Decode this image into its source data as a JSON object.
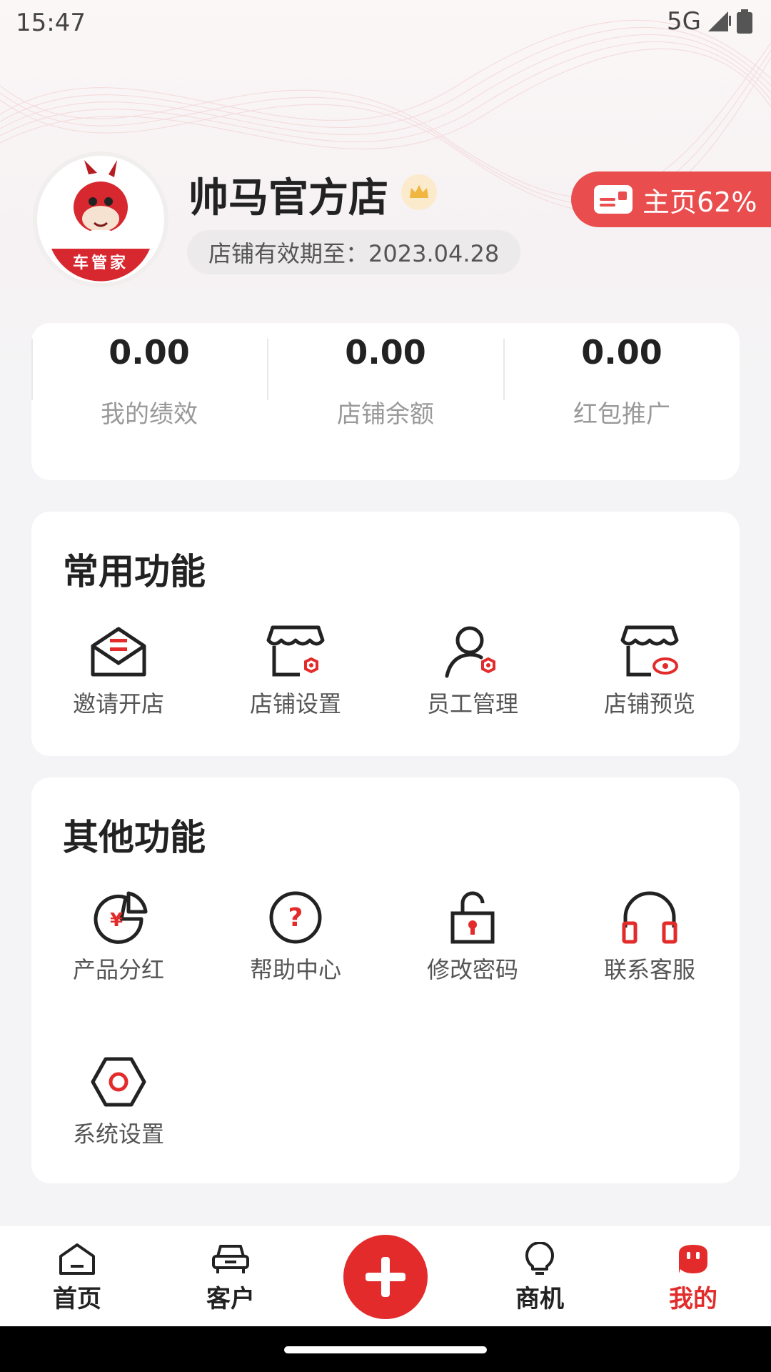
{
  "status_bar": {
    "time": "15:47",
    "network": "5G"
  },
  "profile": {
    "avatar_text": "车管家",
    "shop_name": "帅马官方店",
    "expire_text": "店铺有效期至：2023.04.28",
    "home_progress_label": "主页62%"
  },
  "stats": [
    {
      "value": "0.00",
      "label": "我的绩效"
    },
    {
      "value": "0.00",
      "label": "店铺余额"
    },
    {
      "value": "0.00",
      "label": "红包推广"
    }
  ],
  "common_functions": {
    "title": "常用功能",
    "items": [
      {
        "label": "邀请开店",
        "icon": "invite-mail-icon"
      },
      {
        "label": "店铺设置",
        "icon": "store-settings-icon"
      },
      {
        "label": "员工管理",
        "icon": "staff-manage-icon"
      },
      {
        "label": "店铺预览",
        "icon": "store-preview-icon"
      }
    ]
  },
  "other_functions": {
    "title": "其他功能",
    "items": [
      {
        "label": "产品分红",
        "icon": "dividend-icon"
      },
      {
        "label": "帮助中心",
        "icon": "help-icon"
      },
      {
        "label": "修改密码",
        "icon": "lock-icon"
      },
      {
        "label": "联系客服",
        "icon": "headset-icon"
      },
      {
        "label": "系统设置",
        "icon": "settings-icon"
      }
    ]
  },
  "tabbar": {
    "items": [
      {
        "label": "首页",
        "icon": "home-icon"
      },
      {
        "label": "客户",
        "icon": "car-icon"
      },
      {
        "label": "商机",
        "icon": "bulb-icon"
      },
      {
        "label": "我的",
        "icon": "profile-icon",
        "active": true
      }
    ],
    "add_icon": "plus-icon"
  },
  "colors": {
    "accent": "#e32b2b",
    "progress_bg": "#ea4d4d",
    "crown": "#f0b640"
  }
}
